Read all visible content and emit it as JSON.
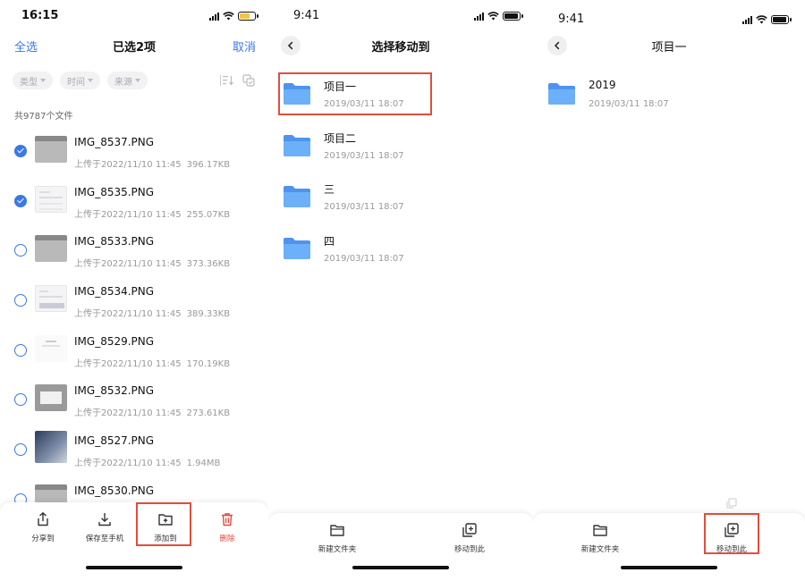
{
  "screen1": {
    "status": {
      "time": "16:15"
    },
    "nav": {
      "left": "全选",
      "title": "已选2项",
      "right": "取消"
    },
    "filters": [
      "类型",
      "时间",
      "来源"
    ],
    "count": "共9787个文件",
    "files": [
      {
        "name": "IMG_8537.PNG",
        "uploaded": "上传于2022/11/10 11:45",
        "size": "396.17KB",
        "checked": true
      },
      {
        "name": "IMG_8535.PNG",
        "uploaded": "上传于2022/11/10 11:45",
        "size": "255.07KB",
        "checked": true
      },
      {
        "name": "IMG_8533.PNG",
        "uploaded": "上传于2022/11/10 11:45",
        "size": "373.36KB",
        "checked": false
      },
      {
        "name": "IMG_8534.PNG",
        "uploaded": "上传于2022/11/10 11:45",
        "size": "389.33KB",
        "checked": false
      },
      {
        "name": "IMG_8529.PNG",
        "uploaded": "上传于2022/11/10 11:45",
        "size": "170.19KB",
        "checked": false
      },
      {
        "name": "IMG_8532.PNG",
        "uploaded": "上传于2022/11/10 11:45",
        "size": "273.61KB",
        "checked": false
      },
      {
        "name": "IMG_8527.PNG",
        "uploaded": "上传于2022/11/10 11:45",
        "size": "1.94MB",
        "checked": false
      },
      {
        "name": "IMG_8530.PNG",
        "uploaded": "",
        "size": "",
        "checked": false
      }
    ],
    "toolbar": {
      "share": "分享到",
      "save": "保存至手机",
      "add": "添加到",
      "delete": "删除"
    }
  },
  "screen2": {
    "status": {
      "time": "9:41"
    },
    "nav": {
      "title": "选择移动到"
    },
    "folders": [
      {
        "name": "项目一",
        "date": "2019/03/11 18:07"
      },
      {
        "name": "项目二",
        "date": "2019/03/11 18:07"
      },
      {
        "name": "三",
        "date": "2019/03/11 18:07"
      },
      {
        "name": "四",
        "date": "2019/03/11 18:07"
      }
    ],
    "toolbar": {
      "new_folder": "新建文件夹",
      "move_here": "移动到此"
    }
  },
  "screen3": {
    "status": {
      "time": "9:41"
    },
    "nav": {
      "title": "项目一"
    },
    "folders": [
      {
        "name": "2019",
        "date": "2019/03/11 18:07"
      }
    ],
    "toolbar": {
      "new_folder": "新建文件夹",
      "move_here": "移动到此"
    }
  },
  "colors": {
    "accent": "#3a78e6",
    "highlight": "#e04e3c",
    "delete": "#e5483c",
    "folder": "#5ea2f5"
  }
}
